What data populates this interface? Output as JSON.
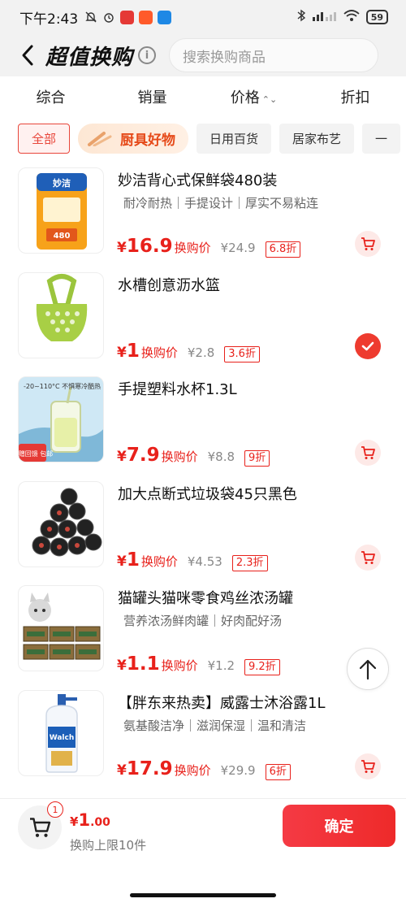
{
  "status_bar": {
    "time": "下午2:43",
    "battery": "59",
    "network": "HD"
  },
  "header": {
    "title": "超值换购",
    "search_placeholder": "搜索换购商品"
  },
  "sort_tabs": [
    {
      "label": "综合"
    },
    {
      "label": "销量"
    },
    {
      "label": "价格"
    },
    {
      "label": "折扣"
    }
  ],
  "categories": [
    {
      "label": "全部",
      "active": true
    },
    {
      "label": "厨具好物",
      "featured": true
    },
    {
      "label": "日用百货"
    },
    {
      "label": "居家布艺"
    },
    {
      "label": "一"
    }
  ],
  "products": [
    {
      "name": "妙洁背心式保鲜袋480装",
      "tags": "耐冷耐热｜手提设计｜厚实不易粘连",
      "currency": "¥",
      "price": "16.9",
      "price_label": "换购价",
      "original": "¥24.9",
      "discount": "6.8折",
      "selected": false,
      "thumb_text": "妙洁"
    },
    {
      "name": "水槽创意沥水篮",
      "tags": "",
      "currency": "¥",
      "price": "1",
      "price_label": "换购价",
      "original": "¥2.8",
      "discount": "3.6折",
      "selected": true
    },
    {
      "name": "手提塑料水杯1.3L",
      "tags": "",
      "currency": "¥",
      "price": "7.9",
      "price_label": "换购价",
      "original": "¥8.8",
      "discount": "9折",
      "selected": false,
      "thumb_text": "-20~110°C 不惧寒冷酷热",
      "thumb_badge": "买赠回馈 包邮"
    },
    {
      "name": "加大点断式垃圾袋45只黑色",
      "tags": "",
      "currency": "¥",
      "price": "1",
      "price_label": "换购价",
      "original": "¥4.53",
      "discount": "2.3折",
      "selected": false
    },
    {
      "name": "猫罐头猫咪零食鸡丝浓汤罐",
      "tags": "营养浓汤鲜肉罐｜好肉配好汤",
      "currency": "¥",
      "price": "1.1",
      "price_label": "换购价",
      "original": "¥1.2",
      "discount": "9.2折",
      "selected": false
    },
    {
      "name": "【胖东来热卖】威露士沐浴露1L",
      "tags": "氨基酸洁净｜滋润保湿｜温和清洁",
      "currency": "¥",
      "price": "17.9",
      "price_label": "换购价",
      "original": "¥29.9",
      "discount": "6折",
      "selected": false,
      "thumb_text": "Walch"
    }
  ],
  "bottom_bar": {
    "cart_count": "1",
    "total_currency": "¥",
    "total_int": "1",
    "total_dec": ".00",
    "limit_text": "换购上限10件",
    "confirm_label": "确定"
  },
  "colors": {
    "accent": "#e8211b",
    "confirm_bg": "#f03a3f",
    "header_bg": "#f2f2f2"
  }
}
